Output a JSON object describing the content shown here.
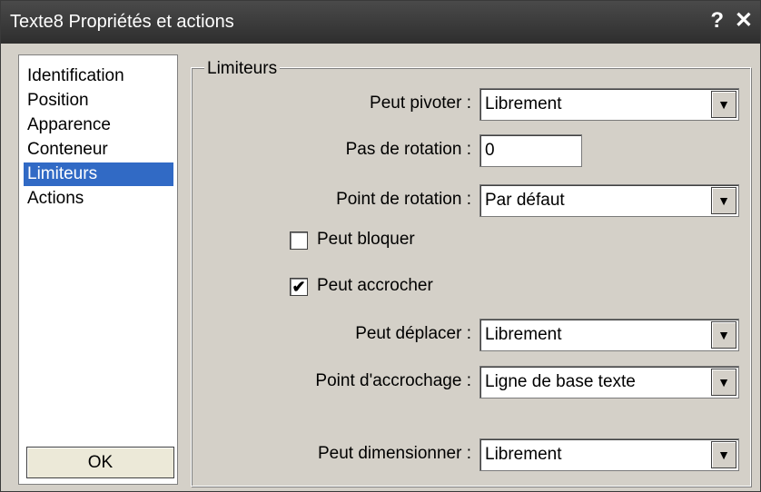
{
  "window": {
    "title": "Texte8 Propriétés et actions",
    "help_label": "?",
    "close_label": "✕"
  },
  "sidebar": {
    "items": [
      {
        "label": "Identification",
        "active": false
      },
      {
        "label": "Position",
        "active": false
      },
      {
        "label": "Apparence",
        "active": false
      },
      {
        "label": "Conteneur",
        "active": false
      },
      {
        "label": "Limiteurs",
        "active": true
      },
      {
        "label": "Actions",
        "active": false
      }
    ],
    "ok_label": "OK"
  },
  "group": {
    "title": "Limiteurs",
    "peut_pivoter": {
      "label": "Peut pivoter :",
      "value": "Librement"
    },
    "pas_rotation": {
      "label": "Pas de rotation :",
      "value": "0"
    },
    "point_rotation": {
      "label": "Point de rotation :",
      "value": "Par défaut"
    },
    "peut_bloquer": {
      "label": "Peut bloquer",
      "checked": false
    },
    "peut_accrocher": {
      "label": "Peut accrocher",
      "checked": true
    },
    "peut_deplacer": {
      "label": "Peut déplacer :",
      "value": "Librement"
    },
    "point_accrochage": {
      "label": "Point d'accrochage :",
      "value": "Ligne de base texte"
    },
    "peut_dimensionner": {
      "label": "Peut dimensionner :",
      "value": "Librement"
    }
  },
  "icons": {
    "dropdown": "triangle-down-icon",
    "check": "checkmark-icon"
  }
}
